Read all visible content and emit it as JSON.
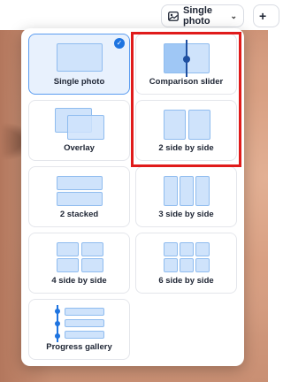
{
  "toolbar": {
    "mode_label": "Single photo",
    "add_label": "+"
  },
  "layout_options": [
    {
      "id": "single",
      "label": "Single photo",
      "selected": true
    },
    {
      "id": "comparison",
      "label": "Comparison slider",
      "selected": false
    },
    {
      "id": "overlay",
      "label": "Overlay",
      "selected": false
    },
    {
      "id": "two-side",
      "label": "2 side by side",
      "selected": false
    },
    {
      "id": "two-stacked",
      "label": "2 stacked",
      "selected": false
    },
    {
      "id": "three-side",
      "label": "3 side by side",
      "selected": false
    },
    {
      "id": "four-side",
      "label": "4 side by side",
      "selected": false
    },
    {
      "id": "six-side",
      "label": "6 side by side",
      "selected": false
    },
    {
      "id": "progress",
      "label": "Progress gallery",
      "selected": false
    }
  ],
  "icons": {
    "selected_check": "✓",
    "chevron": "⌄"
  },
  "colors": {
    "accent": "#1e74e0",
    "highlight": "#e01b1b",
    "selected_bg": "#e8f1fd"
  }
}
